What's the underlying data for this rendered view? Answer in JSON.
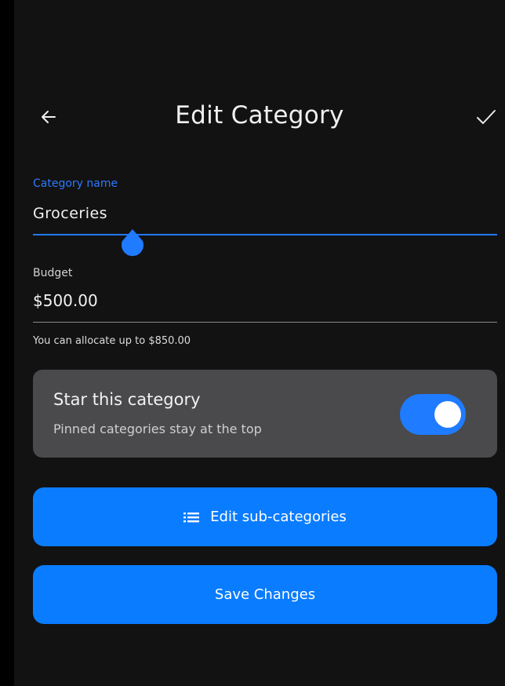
{
  "appbar": {
    "title": "Edit Category",
    "back_icon": "arrow-left-icon",
    "confirm_icon": "check-icon"
  },
  "category_name": {
    "label": "Category name",
    "value": "Groceries"
  },
  "budget": {
    "label": "Budget",
    "value": "$500.00",
    "helper": "You can allocate up to $850.00"
  },
  "star": {
    "title": "Star this category",
    "subtitle": "Pinned categories stay at the top",
    "enabled": true
  },
  "buttons": {
    "edit_sub_label": "Edit sub-categories",
    "edit_sub_icon": "list-icon",
    "save_label": "Save Changes"
  },
  "colors": {
    "background": "#121212",
    "accent": "#0a7cff",
    "card": "#4a4a4c",
    "label_focus": "#2c79ff"
  }
}
